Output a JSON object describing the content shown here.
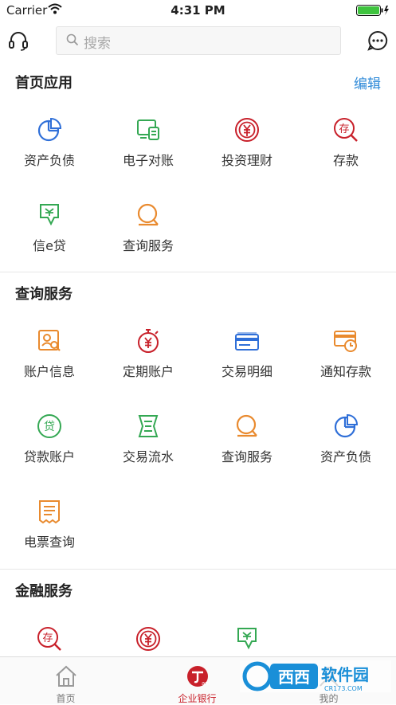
{
  "status": {
    "carrier": "Carrier",
    "time": "4:31 PM"
  },
  "search": {
    "placeholder": "搜索"
  },
  "home_apps": {
    "title": "首页应用",
    "edit": "编辑",
    "items": [
      {
        "label": "资产负债",
        "icon": "pie-chart-icon"
      },
      {
        "label": "电子对账",
        "icon": "e-statement-icon"
      },
      {
        "label": "投资理财",
        "icon": "yuan-coin-icon"
      },
      {
        "label": "存款",
        "icon": "deposit-search-icon"
      },
      {
        "label": "信e贷",
        "icon": "loan-doc-icon"
      },
      {
        "label": "查询服务",
        "icon": "query-icon"
      }
    ]
  },
  "query_services": {
    "title": "查询服务",
    "items": [
      {
        "label": "账户信息",
        "icon": "account-info-icon"
      },
      {
        "label": "定期账户",
        "icon": "timer-yuan-icon"
      },
      {
        "label": "交易明细",
        "icon": "card-icon"
      },
      {
        "label": "通知存款",
        "icon": "notice-deposit-icon"
      },
      {
        "label": "贷款账户",
        "icon": "loan-circle-icon"
      },
      {
        "label": "交易流水",
        "icon": "flow-list-icon"
      },
      {
        "label": "查询服务",
        "icon": "query-icon"
      },
      {
        "label": "资产负债",
        "icon": "pie-chart-icon"
      },
      {
        "label": "电票查询",
        "icon": "bill-icon"
      }
    ]
  },
  "finance_services": {
    "title": "金融服务",
    "items": [
      {
        "icon": "deposit-search-icon"
      },
      {
        "icon": "yuan-coin-icon"
      },
      {
        "icon": "loan-doc-icon"
      }
    ]
  },
  "tabbar": {
    "home": "首页",
    "bank": "企业银行",
    "mine": "我的"
  },
  "watermark": {
    "text": "西西软件园",
    "sub": "CR173.COM"
  },
  "colors": {
    "blue": "#2f8ad8",
    "red": "#c8202a",
    "orange": "#e98a2e",
    "green": "#34a853",
    "icon_blue": "#2f6fd8"
  }
}
